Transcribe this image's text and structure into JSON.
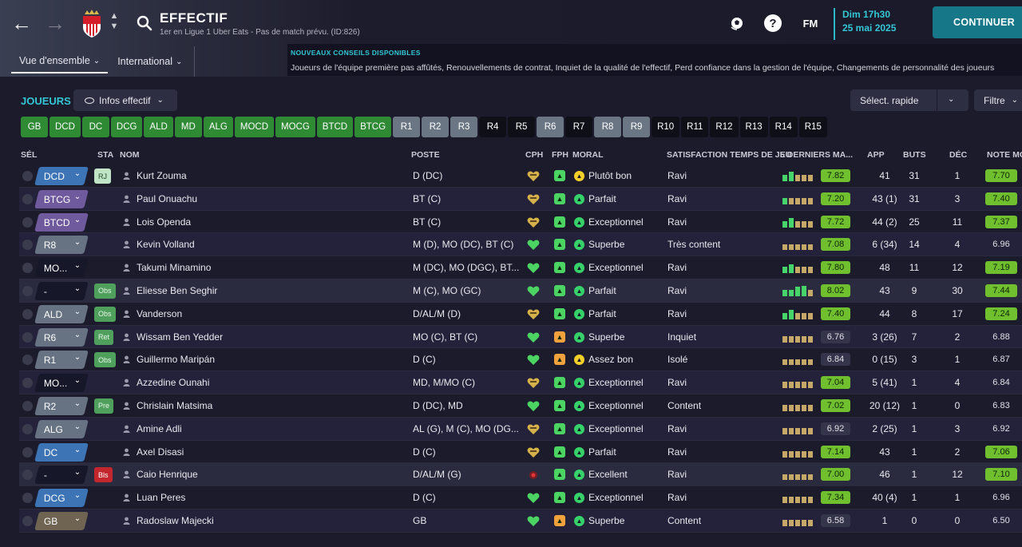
{
  "header": {
    "title": "EFFECTIF",
    "subtitle": "1er en Ligue 1 Uber Eats - Pas de match prévu. (ID:826)",
    "tabs": [
      {
        "label": "Vue d'ensemble",
        "active": true
      },
      {
        "label": "International",
        "active": false
      }
    ],
    "date_line1": "Dim 17h30",
    "date_line2": "25 mai 2025",
    "fm_label": "FM",
    "help_label": "?",
    "continue_label": "CONTINUER"
  },
  "advice": {
    "title": "NOUVEAUX CONSEILS DISPONIBLES",
    "text": "Joueurs de l'équipe première pas affûtés, Renouvellements de contrat, Inquiet de la qualité de l'effectif, Perd confiance dans la gestion de l'équipe, Changements de personnalité des joueurs"
  },
  "toolbar": {
    "section_label": "JOUEURS",
    "view_label": "Infos effectif",
    "quick_select_label": "Sélect. rapide",
    "filter_label": "Filtre"
  },
  "chips": [
    {
      "label": "GB",
      "style": "green"
    },
    {
      "label": "DCD",
      "style": "green"
    },
    {
      "label": "DC",
      "style": "green"
    },
    {
      "label": "DCG",
      "style": "green"
    },
    {
      "label": "ALD",
      "style": "green"
    },
    {
      "label": "MD",
      "style": "green"
    },
    {
      "label": "ALG",
      "style": "green"
    },
    {
      "label": "MOCD",
      "style": "green"
    },
    {
      "label": "MOCG",
      "style": "green"
    },
    {
      "label": "BTCD",
      "style": "green"
    },
    {
      "label": "BTCG",
      "style": "green"
    },
    {
      "label": "R1",
      "style": "grey"
    },
    {
      "label": "R2",
      "style": "grey"
    },
    {
      "label": "R3",
      "style": "grey"
    },
    {
      "label": "R4",
      "style": "black"
    },
    {
      "label": "R5",
      "style": "black"
    },
    {
      "label": "R6",
      "style": "grey"
    },
    {
      "label": "R7",
      "style": "black"
    },
    {
      "label": "R8",
      "style": "grey"
    },
    {
      "label": "R9",
      "style": "grey"
    },
    {
      "label": "R10",
      "style": "black"
    },
    {
      "label": "R11",
      "style": "black"
    },
    {
      "label": "R12",
      "style": "black"
    },
    {
      "label": "R13",
      "style": "black"
    },
    {
      "label": "R14",
      "style": "black"
    },
    {
      "label": "R15",
      "style": "black"
    }
  ],
  "columns": {
    "sel": "SÉL",
    "sta": "STA",
    "nom": "NOM",
    "poste": "POSTE",
    "cph": "CPH",
    "fph": "FPH",
    "moral": "MORAL",
    "satisfaction": "SATISFACTION TEMPS DE JEU",
    "form": "5 DERNIERS MA...",
    "app": "APP",
    "buts": "BUTS",
    "dec": "DÉC",
    "note_moy": "NOTE MO"
  },
  "colors": {
    "accent": "#33c7d6",
    "continue": "#157787",
    "green_note": "#6fbf2e"
  },
  "players": [
    {
      "pos": "DCD",
      "pos_style": "blue",
      "sta": "RJ",
      "sta_style": "light",
      "name": "Kurt Zouma",
      "poste": "D (DC)",
      "cph": "gold",
      "fph": "green",
      "moral_icon": "yellow",
      "moral": "Plutôt bon",
      "satisfaction": "Ravi",
      "form": [
        0.6,
        0.9,
        0.6,
        0.6,
        0.6
      ],
      "form_colors": [
        "g",
        "g",
        "y",
        "y",
        "y"
      ],
      "note": "7.82",
      "note_style": "g",
      "app": "41",
      "buts": "31",
      "dec": "1",
      "note_moy": "7.70",
      "nm_style": "g"
    },
    {
      "pos": "BTCG",
      "pos_style": "purple",
      "sta": "",
      "sta_style": "",
      "name": "Paul Onuachu",
      "poste": "BT (C)",
      "cph": "gold",
      "fph": "green",
      "moral_icon": "green",
      "moral": "Parfait",
      "satisfaction": "Ravi",
      "form": [
        0.6,
        0.6,
        0.6,
        0.6,
        0.6
      ],
      "form_colors": [
        "g",
        "y",
        "y",
        "y",
        "y"
      ],
      "note": "7.20",
      "note_style": "g",
      "app": "43 (1)",
      "buts": "31",
      "dec": "3",
      "note_moy": "7.40",
      "nm_style": "g"
    },
    {
      "pos": "BTCD",
      "pos_style": "purple",
      "sta": "",
      "sta_style": "",
      "name": "Lois Openda",
      "poste": "BT (C)",
      "cph": "gold",
      "fph": "green",
      "moral_icon": "green",
      "moral": "Exceptionnel",
      "satisfaction": "Ravi",
      "form": [
        0.6,
        0.9,
        0.6,
        0.6,
        0.6
      ],
      "form_colors": [
        "g",
        "g",
        "y",
        "y",
        "y"
      ],
      "note": "7.72",
      "note_style": "g",
      "app": "44 (2)",
      "buts": "25",
      "dec": "11",
      "note_moy": "7.37",
      "nm_style": "g"
    },
    {
      "pos": "R8",
      "pos_style": "grey",
      "sta": "",
      "sta_style": "",
      "name": "Kevin Volland",
      "poste": "M (D), MO (DC), BT (C)",
      "cph": "green",
      "fph": "green",
      "moral_icon": "green",
      "moral": "Superbe",
      "satisfaction": "Très content",
      "form": [
        0.6,
        0.6,
        0.6,
        0.6,
        0.6
      ],
      "form_colors": [
        "y",
        "y",
        "y",
        "y",
        "y"
      ],
      "note": "7.08",
      "note_style": "g",
      "app": "6 (34)",
      "buts": "14",
      "dec": "4",
      "note_moy": "6.96",
      "nm_style": "d"
    },
    {
      "pos": "MO...",
      "pos_style": "black",
      "sta": "",
      "sta_style": "",
      "name": "Takumi Minamino",
      "poste": "M (DC), MO (DGC), BT...",
      "cph": "green",
      "fph": "green",
      "moral_icon": "green",
      "moral": "Exceptionnel",
      "satisfaction": "Ravi",
      "form": [
        0.6,
        0.9,
        0.6,
        0.6,
        0.6
      ],
      "form_colors": [
        "g",
        "g",
        "y",
        "y",
        "y"
      ],
      "note": "7.80",
      "note_style": "g",
      "app": "48",
      "buts": "11",
      "dec": "12",
      "note_moy": "7.19",
      "nm_style": "g"
    },
    {
      "pos": "-",
      "pos_style": "black",
      "sta": "Obs",
      "sta_style": "mid",
      "name": "Eliesse Ben Seghir",
      "poste": "M (C), MO (GC)",
      "cph": "green",
      "fph": "green",
      "moral_icon": "green",
      "moral": "Parfait",
      "satisfaction": "Ravi",
      "form": [
        0.6,
        0.6,
        0.9,
        1.0,
        0.6
      ],
      "form_colors": [
        "g",
        "g",
        "g",
        "g",
        "y"
      ],
      "note": "8.02",
      "note_style": "g",
      "app": "43",
      "buts": "9",
      "dec": "30",
      "note_moy": "7.44",
      "nm_style": "g"
    },
    {
      "pos": "ALD",
      "pos_style": "grey",
      "sta": "Obs",
      "sta_style": "mid",
      "name": "Vanderson",
      "poste": "D/AL/M (D)",
      "cph": "gold",
      "fph": "green",
      "moral_icon": "green",
      "moral": "Parfait",
      "satisfaction": "Ravi",
      "form": [
        0.6,
        0.9,
        0.6,
        0.6,
        0.6
      ],
      "form_colors": [
        "g",
        "g",
        "y",
        "y",
        "y"
      ],
      "note": "7.40",
      "note_style": "g",
      "app": "44",
      "buts": "8",
      "dec": "17",
      "note_moy": "7.24",
      "nm_style": "g"
    },
    {
      "pos": "R6",
      "pos_style": "grey",
      "sta": "Ret",
      "sta_style": "mid",
      "name": "Wissam Ben Yedder",
      "poste": "MO (C), BT (C)",
      "cph": "green",
      "fph": "orange",
      "moral_icon": "green",
      "moral": "Superbe",
      "satisfaction": "Inquiet",
      "form": [
        0.6,
        0.6,
        0.6,
        0.6,
        0.6
      ],
      "form_colors": [
        "y",
        "y",
        "y",
        "y",
        "y"
      ],
      "note": "6.76",
      "note_style": "d",
      "app": "3 (26)",
      "buts": "7",
      "dec": "2",
      "note_moy": "6.88",
      "nm_style": "d"
    },
    {
      "pos": "R1",
      "pos_style": "grey",
      "sta": "Obs",
      "sta_style": "mid",
      "name": "Guillermo Maripán",
      "poste": "D (C)",
      "cph": "green",
      "fph": "orange",
      "moral_icon": "yellow",
      "moral": "Assez bon",
      "satisfaction": "Isolé",
      "form": [
        0.6,
        0.6,
        0.6,
        0.6,
        0.6
      ],
      "form_colors": [
        "y",
        "y",
        "y",
        "y",
        "y"
      ],
      "note": "6.84",
      "note_style": "d",
      "app": "0 (15)",
      "buts": "3",
      "dec": "1",
      "note_moy": "6.87",
      "nm_style": "d"
    },
    {
      "pos": "MO...",
      "pos_style": "black",
      "sta": "",
      "sta_style": "",
      "name": "Azzedine Ounahi",
      "poste": "MD, M/MO (C)",
      "cph": "gold",
      "fph": "green",
      "moral_icon": "green",
      "moral": "Exceptionnel",
      "satisfaction": "Ravi",
      "form": [
        0.6,
        0.6,
        0.6,
        0.6,
        0.6
      ],
      "form_colors": [
        "y",
        "y",
        "y",
        "y",
        "y"
      ],
      "note": "7.04",
      "note_style": "g",
      "app": "5 (41)",
      "buts": "1",
      "dec": "4",
      "note_moy": "6.84",
      "nm_style": "d"
    },
    {
      "pos": "R2",
      "pos_style": "grey",
      "sta": "Pre",
      "sta_style": "mid",
      "name": "Chrislain Matsima",
      "poste": "D (DC), MD",
      "cph": "green",
      "fph": "green",
      "moral_icon": "green",
      "moral": "Exceptionnel",
      "satisfaction": "Content",
      "form": [
        0.6,
        0.6,
        0.6,
        0.6,
        0.6
      ],
      "form_colors": [
        "y",
        "y",
        "y",
        "y",
        "y"
      ],
      "note": "7.02",
      "note_style": "g",
      "app": "20 (12)",
      "buts": "1",
      "dec": "0",
      "note_moy": "6.83",
      "nm_style": "d"
    },
    {
      "pos": "ALG",
      "pos_style": "grey",
      "sta": "",
      "sta_style": "",
      "name": "Amine Adli",
      "poste": "AL (G), M (C), MO (DG...",
      "cph": "gold",
      "fph": "green",
      "moral_icon": "green",
      "moral": "Exceptionnel",
      "satisfaction": "Ravi",
      "form": [
        0.6,
        0.6,
        0.6,
        0.6,
        0.6
      ],
      "form_colors": [
        "y",
        "y",
        "y",
        "y",
        "y"
      ],
      "note": "6.92",
      "note_style": "d",
      "app": "2 (25)",
      "buts": "1",
      "dec": "3",
      "note_moy": "6.92",
      "nm_style": "d"
    },
    {
      "pos": "DC",
      "pos_style": "blue",
      "sta": "",
      "sta_style": "",
      "name": "Axel Disasi",
      "poste": "D (C)",
      "cph": "gold",
      "fph": "green",
      "moral_icon": "green",
      "moral": "Parfait",
      "satisfaction": "Ravi",
      "form": [
        0.6,
        0.6,
        0.6,
        0.6,
        0.6
      ],
      "form_colors": [
        "y",
        "y",
        "y",
        "y",
        "y"
      ],
      "note": "7.14",
      "note_style": "g",
      "app": "43",
      "buts": "1",
      "dec": "2",
      "note_moy": "7.06",
      "nm_style": "g"
    },
    {
      "pos": "-",
      "pos_style": "black",
      "sta": "Bls",
      "sta_style": "red",
      "name": "Caio Henrique",
      "poste": "D/AL/M (G)",
      "cph": "red",
      "fph": "green",
      "moral_icon": "green",
      "moral": "Excellent",
      "satisfaction": "Ravi",
      "form": [
        0.6,
        0.6,
        0.6,
        0.6,
        0.6
      ],
      "form_colors": [
        "y",
        "y",
        "y",
        "y",
        "y"
      ],
      "note": "7.00",
      "note_style": "g",
      "app": "46",
      "buts": "1",
      "dec": "12",
      "note_moy": "7.10",
      "nm_style": "g"
    },
    {
      "pos": "DCG",
      "pos_style": "blue",
      "sta": "",
      "sta_style": "",
      "name": "Luan Peres",
      "poste": "D (C)",
      "cph": "green",
      "fph": "green",
      "moral_icon": "green",
      "moral": "Exceptionnel",
      "satisfaction": "Ravi",
      "form": [
        0.6,
        0.6,
        0.6,
        0.6,
        0.6
      ],
      "form_colors": [
        "y",
        "y",
        "y",
        "y",
        "y"
      ],
      "note": "7.34",
      "note_style": "g",
      "app": "40 (4)",
      "buts": "1",
      "dec": "1",
      "note_moy": "6.96",
      "nm_style": "d"
    },
    {
      "pos": "GB",
      "pos_style": "tan",
      "sta": "",
      "sta_style": "",
      "name": "Radoslaw Majecki",
      "poste": "GB",
      "cph": "green",
      "fph": "orange",
      "moral_icon": "green",
      "moral": "Superbe",
      "satisfaction": "Content",
      "form": [
        0.6,
        0.6,
        0.6,
        0.6,
        0.6
      ],
      "form_colors": [
        "y",
        "y",
        "y",
        "y",
        "y"
      ],
      "note": "6.58",
      "note_style": "d",
      "app": "1",
      "buts": "0",
      "dec": "0",
      "note_moy": "6.50",
      "nm_style": "d"
    }
  ]
}
